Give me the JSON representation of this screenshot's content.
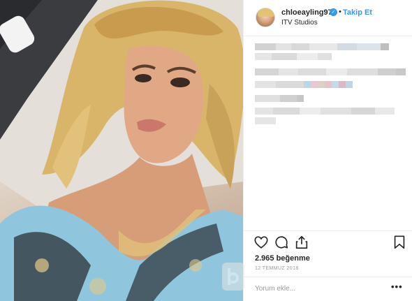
{
  "post": {
    "username": "chloeayling97",
    "separator": "•",
    "follow_label": "Takip Et",
    "location": "ITV Studios",
    "likes_text": "2.965 beğenme",
    "date_text": "12 TEMMUZ 2018",
    "comment_placeholder": "Yorum ekle...",
    "more_label": "•••"
  },
  "icons": {
    "verified": "verified-badge-icon",
    "like": "heart-icon",
    "comment": "speech-bubble-icon",
    "share": "share-icon",
    "save": "bookmark-icon",
    "more": "ellipsis-icon"
  },
  "colors": {
    "accent": "#3897f0",
    "text": "#262626",
    "muted": "#999999",
    "border": "#efefef"
  }
}
